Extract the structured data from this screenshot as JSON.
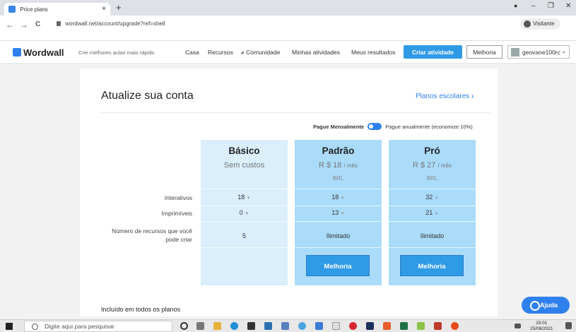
{
  "browser": {
    "tab_title": "Price plans",
    "tab_close": "×",
    "new_tab": "+",
    "url": "wordwall.net/account/upgrade?ref=shell",
    "profile_label": "Visitante",
    "back": "←",
    "forward": "→",
    "reload": "C",
    "minimize": "–",
    "restore": "❐",
    "close": "✕"
  },
  "header": {
    "logo": "Wordwall",
    "tagline": "Crie melhores aulas mais rápido",
    "nav": [
      "Casa",
      "Recursos",
      "Comunidade",
      "Minhas atividades",
      "Meus resultados"
    ],
    "create_button": "Criar atividade",
    "upgrade_button": "Melhoria",
    "username": "geovane100rc"
  },
  "main": {
    "title": "Atualize sua conta",
    "school_plans_link": "Planos escolares",
    "billing": {
      "monthly": "Pague Mensalmente",
      "annual": "Pague anualmente (economize 10%)"
    },
    "row_labels": [
      "Interativos",
      "Imprimíveis",
      "Número de recursos que você pode criar"
    ],
    "plans": [
      {
        "name": "Básico",
        "price": "Sem custos",
        "currency": "",
        "interactives": "18",
        "printables": "0",
        "resources": "5",
        "button": ""
      },
      {
        "name": "Padrão",
        "price": "R $ 18",
        "per": "/ mês",
        "currency": "BRL",
        "interactives": "18",
        "printables": "13",
        "resources": "Ilimitado",
        "button": "Melhoria"
      },
      {
        "name": "Pró",
        "price": "R $ 27",
        "per": "/ mês",
        "currency": "BRL",
        "interactives": "32",
        "printables": "21",
        "resources": "Ilimitado",
        "button": "Melhoria"
      }
    ],
    "included_heading": "Incluído em todos os planos",
    "help_button": "Ajuda"
  },
  "taskbar": {
    "search_placeholder": "Digite aqui para pesquisar",
    "time": "15:01",
    "date": "25/08/2021"
  },
  "colors": {
    "accent": "#2f80ed",
    "button": "#2f9ae5",
    "basic_column": "#daeefb",
    "paid_column": "#aadcfa"
  }
}
